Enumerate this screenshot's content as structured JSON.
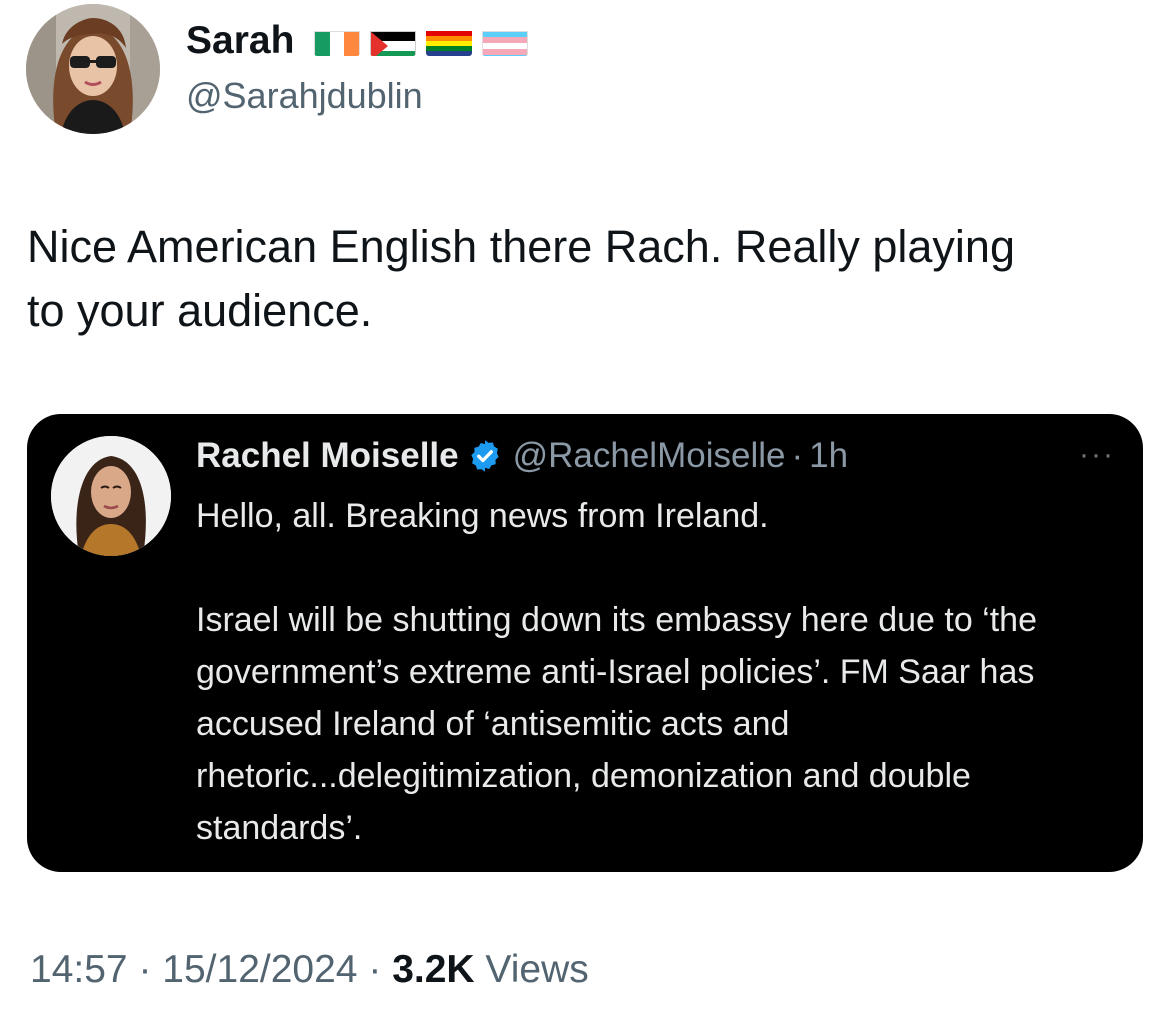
{
  "tweet": {
    "author": {
      "display_name": "Sarah",
      "flags": [
        "ireland-flag",
        "palestine-flag",
        "rainbow-flag",
        "transgender-flag"
      ],
      "handle": "@Sarahjdublin"
    },
    "text_line_1": "Nice American English there Rach. Really playing",
    "text_line_2": "to your audience.",
    "time": "14:57",
    "date": "15/12/2024",
    "views_count": "3.2K",
    "views_label": "Views",
    "separator": "·"
  },
  "quoted_tweet": {
    "display_name": "Rachel Moiselle",
    "verified": true,
    "handle": "@RachelMoiselle",
    "separator": "·",
    "time_ago": "1h",
    "more_label": "···",
    "paragraph_1": "Hello, all. Breaking news from Ireland.",
    "paragraph_2": "Israel will be shutting down its embassy here due to ‘the government’s extreme anti-Israel policies’. FM Saar has accused Ireland of ‘antisemitic acts and rhetoric...delegitimization, demonization and double standards’."
  },
  "colors": {
    "text_primary": "#0f1419",
    "text_secondary": "#536471",
    "quote_background": "#000000",
    "quote_text": "#e7e9ea",
    "quote_secondary": "#8b98a5",
    "verified_blue": "#1d9bf0"
  }
}
